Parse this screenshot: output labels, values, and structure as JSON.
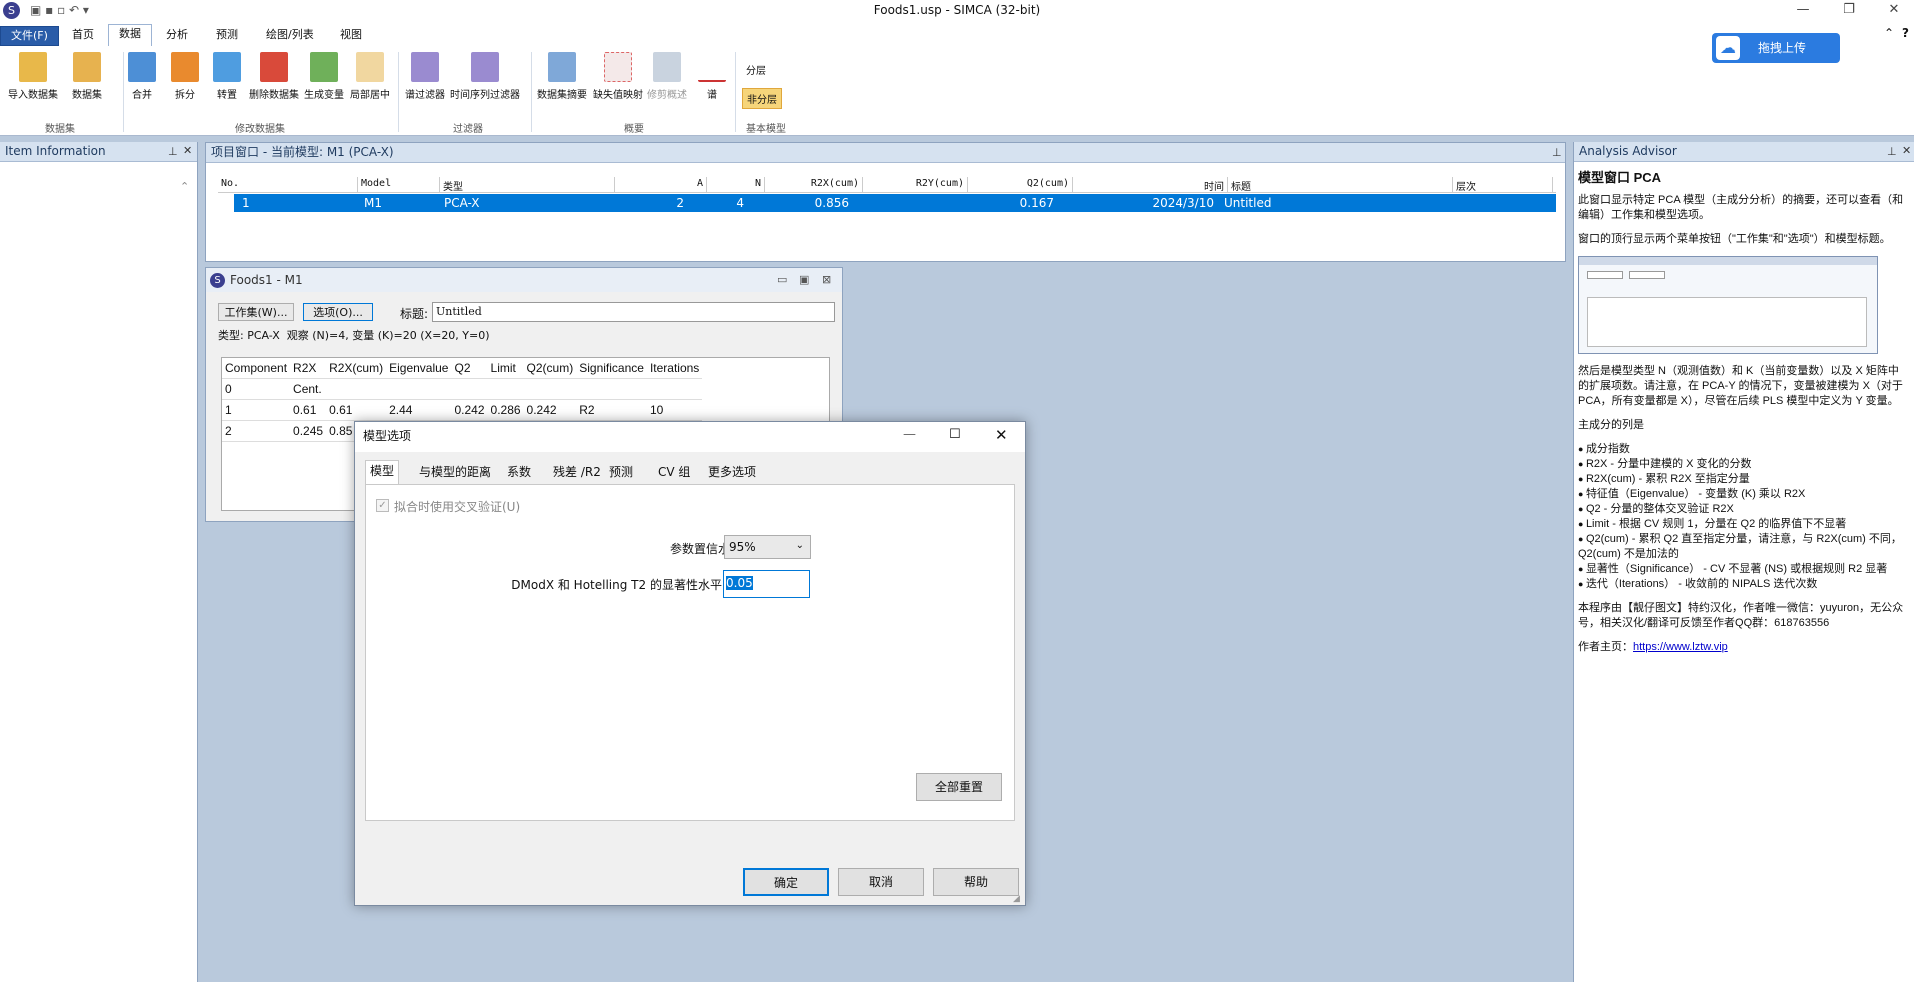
{
  "app": {
    "title": "Foods1.usp - SIMCA (32-bit)"
  },
  "ribbon": {
    "tabs": [
      "文件(F)",
      "首页",
      "数据",
      "分析",
      "预测",
      "绘图/列表",
      "视图"
    ],
    "buttons": [
      "导入数据集",
      "数据集",
      "合并",
      "拆分",
      "转置",
      "删除数据集",
      "生成变量",
      "局部居中",
      "谱过滤器",
      "时间序列过滤器",
      "数据集摘要",
      "缺失值映射",
      "修剪概述",
      "谱",
      "分层",
      "非分层"
    ],
    "groups": [
      "数据集",
      "修改数据集",
      "过滤器",
      "概要",
      "基本模型"
    ],
    "upload_label": "拖拽上传"
  },
  "left_pane": {
    "title": "Item Information"
  },
  "project": {
    "title": "项目窗口 - 当前模型: M1 (PCA-X)",
    "columns": [
      "No.",
      "Model",
      "类型",
      "A",
      "N",
      "R2X(cum)",
      "R2Y(cum)",
      "Q2(cum)",
      "时间",
      "标题",
      "层次"
    ],
    "row": {
      "no": "1",
      "model": "M1",
      "type": "PCA-X",
      "a": "2",
      "n": "4",
      "r2x": "0.856",
      "r2y": "",
      "q2": "0.167",
      "time": "2024/3/10",
      "title": "Untitled"
    }
  },
  "foods": {
    "title": "Foods1 - M1",
    "workset_btn": "工作集(W)...",
    "options_btn": "选项(O)...",
    "title_label": "标题:",
    "title_value": "Untitled",
    "info": "类型: PCA-X  观察 (N)=4, 变量 (K)=20 (X=20, Y=0)",
    "headers": [
      "Component",
      "R2X",
      "R2X(cum)",
      "Eigenvalue",
      "Q2",
      "Limit",
      "Q2(cum)",
      "Significance",
      "Iterations"
    ],
    "rows": [
      [
        "0",
        "Cent.",
        "",
        "",
        "",
        "",
        "",
        "",
        ""
      ],
      [
        "1",
        "0.61",
        "0.61",
        "2.44",
        "0.242",
        "0.286",
        "0.242",
        "R2",
        "10"
      ],
      [
        "2",
        "0.245",
        "0.85",
        "",
        "",
        "",
        "",
        "",
        ""
      ]
    ]
  },
  "dialog": {
    "title": "模型选项",
    "tabs": [
      "模型",
      "与模型的距离",
      "系数",
      "残差 /R2",
      "预测",
      "CV 组",
      "更多选项"
    ],
    "crossval_label": "拟合时使用交叉验证(U)",
    "confidence_label": "参数置信水平:",
    "confidence_value": "95%",
    "dmodx_label": "DModX 和 Hotelling T2 的显著性水平:",
    "dmodx_value": "0.05",
    "reset_btn": "全部重置",
    "ok_btn": "确定",
    "cancel_btn": "取消",
    "help_btn": "帮助"
  },
  "advisor": {
    "pane_title": "Analysis Advisor",
    "heading": "模型窗口 PCA",
    "p1": "此窗口显示特定 PCA 模型（主成分分析）的摘要，还可以查看（和编辑）工作集和模型选项。",
    "p2": "窗口的顶行显示两个菜单按钮（\"工作集\"和\"选项\"）和模型标题。",
    "p3": "然后是模型类型 N（观测值数）和 K（当前变量数）以及 X 矩阵中的扩展项数。请注意，在 PCA-Y 的情况下，变量被建模为 X（对于 PCA，所有变量都是 X），尽管在后续 PLS 模型中定义为 Y 变量。",
    "p4": "主成分的列是",
    "items": [
      "成分指数",
      "R2X - 分量中建模的 X 变化的分数",
      "R2X(cum) - 累积 R2X 至指定分量",
      "特征值（Eigenvalue） - 变量数 (K) 乘以 R2X",
      "Q2 - 分量的整体交叉验证 R2X",
      "Limit - 根据 CV 规则 1，分量在 Q2 的临界值下不显著",
      "Q2(cum) - 累积 Q2 直至指定分量，请注意，与 R2X(cum) 不同，Q2(cum) 不是加法的",
      "显著性（Significance） - CV 不显著 (NS) 或根据规则 R2 显著",
      "迭代（Iterations） - 收敛前的 NIPALS 迭代次数"
    ],
    "p5": "本程序由【靓仔图文】特约汉化，作者唯一微信：yuyuron，无公众号，相关汉化/翻译可反馈至作者QQ群：618763556",
    "p6_label": "作者主页：",
    "p6_link": "https://www.lztw.vip"
  },
  "colors": {
    "accent": "#0078d7",
    "ribbon_tab": "#2a5ca8",
    "pane_header": "#d6e2f0"
  }
}
